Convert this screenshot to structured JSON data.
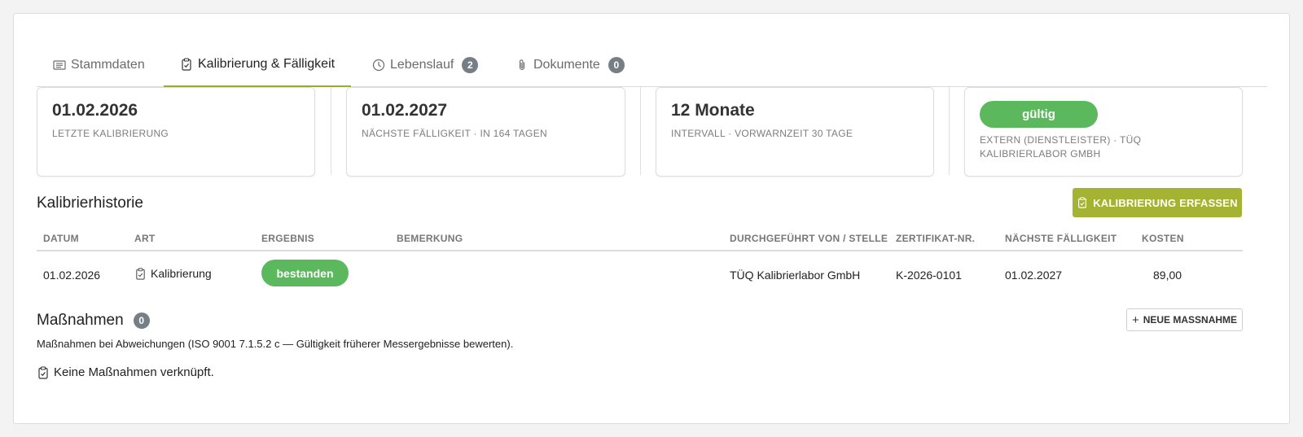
{
  "tabs": [
    {
      "label": "Stammdaten",
      "icon": "list-card-icon"
    },
    {
      "label": "Kalibrierung & Fälligkeit",
      "icon": "clipboard-check-icon",
      "active": true
    },
    {
      "label": "Lebenslauf",
      "icon": "clock-icon",
      "count": "2"
    },
    {
      "label": "Dokumente",
      "icon": "paperclip-icon",
      "count": "0"
    }
  ],
  "cards": {
    "last": {
      "value": "01.02.2026",
      "label": "Letzte Kalibrierung"
    },
    "next": {
      "value": "01.02.2027",
      "label": "Nächste Fälligkeit · in 164 Tagen"
    },
    "interval": {
      "value": "12 Monate",
      "label": "Intervall · Vorwarnzeit 30 Tage"
    },
    "status": {
      "badge": "gültig",
      "label": "Extern (Dienstleister) · TÜQ Kalibrierlabor GmbH"
    }
  },
  "history": {
    "title": "Kalibrierhistorie",
    "add_button": "KALIBRIERUNG ERFASSEN",
    "columns": [
      "DATUM",
      "ART",
      "ERGEBNIS",
      "BEMERKUNG",
      "DURCHGEFÜHRT VON / STELLE",
      "ZERTIFIKAT-NR.",
      "NÄCHSTE FÄLLIGKEIT",
      "KOSTEN"
    ],
    "rows": [
      {
        "date": "01.02.2026",
        "type": "Kalibrierung",
        "result": "bestanden",
        "remark": "",
        "by": "TÜQ Kalibrierlabor GmbH",
        "cert": "K-2026-0101",
        "next_due": "01.02.2027",
        "cost": "89,00"
      }
    ]
  },
  "measures": {
    "title": "Maßnahmen",
    "count": "0",
    "add_button": "NEUE MASSNAHME",
    "description": "Maßnahmen bei Abweichungen (ISO 9001 7.1.5.2 c — Gültigkeit früherer Messergebnisse bewerten).",
    "empty": "Keine Maßnahmen verknüpft."
  },
  "colors": {
    "accent": "#a5b332",
    "success": "#5cb85c",
    "badge": "#777f86"
  }
}
